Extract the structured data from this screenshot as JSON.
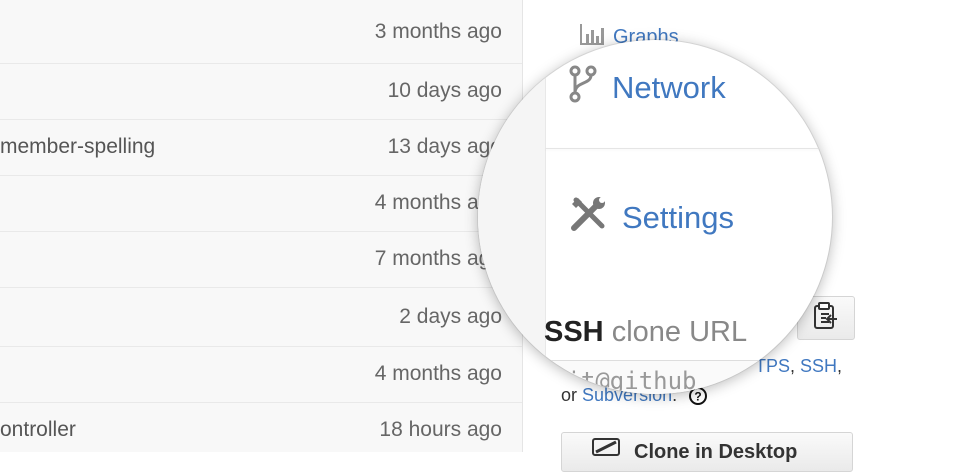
{
  "file_list": {
    "rows": [
      {
        "message": "",
        "age": "3 months ago"
      },
      {
        "message": "",
        "age": "10 days ago"
      },
      {
        "message": "member-spelling",
        "age": "13 days ago"
      },
      {
        "message": "",
        "age": "4 months ago"
      },
      {
        "message": "",
        "age": "7 months ago"
      },
      {
        "message": "",
        "age": "2 days ago"
      },
      {
        "message": "",
        "age": "4 months ago"
      },
      {
        "message": "ontroller",
        "age": "18 hours ago"
      }
    ]
  },
  "sidebar": {
    "graphs_label": "Graphs",
    "network_label": "Network",
    "settings_label": "Settings",
    "clone": {
      "protocol_bold": "SSH",
      "title_rest": "clone URL",
      "url_partial": "git@github",
      "protocols_prefix": "TPS",
      "protocol_https_tail": "TPS",
      "protocol_ssh": "SSH",
      "or_text": "or",
      "protocol_svn": "Subversion",
      "desktop_button": "Clone in Desktop"
    }
  },
  "colors": {
    "link": "#4078c0",
    "muted": "#666666"
  },
  "icons": {
    "graphs": "bar-chart-icon",
    "network": "branch-fork-icon",
    "settings": "tools-icon",
    "clipboard": "clipboard-icon",
    "help": "question-circle-icon",
    "desktop": "monitor-icon"
  }
}
